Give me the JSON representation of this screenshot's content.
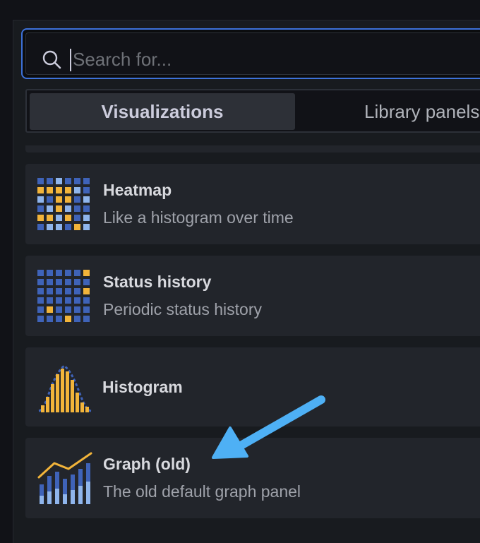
{
  "search": {
    "placeholder": "Search for..."
  },
  "tabs": [
    {
      "label": "Visualizations",
      "active": true
    },
    {
      "label": "Library panels",
      "active": false
    }
  ],
  "visualizations": [
    {
      "title": "Heatmap",
      "description": "Like a histogram over time",
      "icon": "heatmap-icon"
    },
    {
      "title": "Status history",
      "description": "Periodic status history",
      "icon": "status-history-icon"
    },
    {
      "title": "Histogram",
      "description": "",
      "icon": "histogram-icon"
    },
    {
      "title": "Graph (old)",
      "description": "The old default graph panel",
      "icon": "graph-old-icon"
    }
  ],
  "colors": {
    "accent": "#3d71d9",
    "annotation_arrow": "#4eb0f5",
    "icon_yellow": "#f2b43a",
    "icon_blue": "#3f63b8",
    "icon_light_blue": "#8fb5ec"
  }
}
